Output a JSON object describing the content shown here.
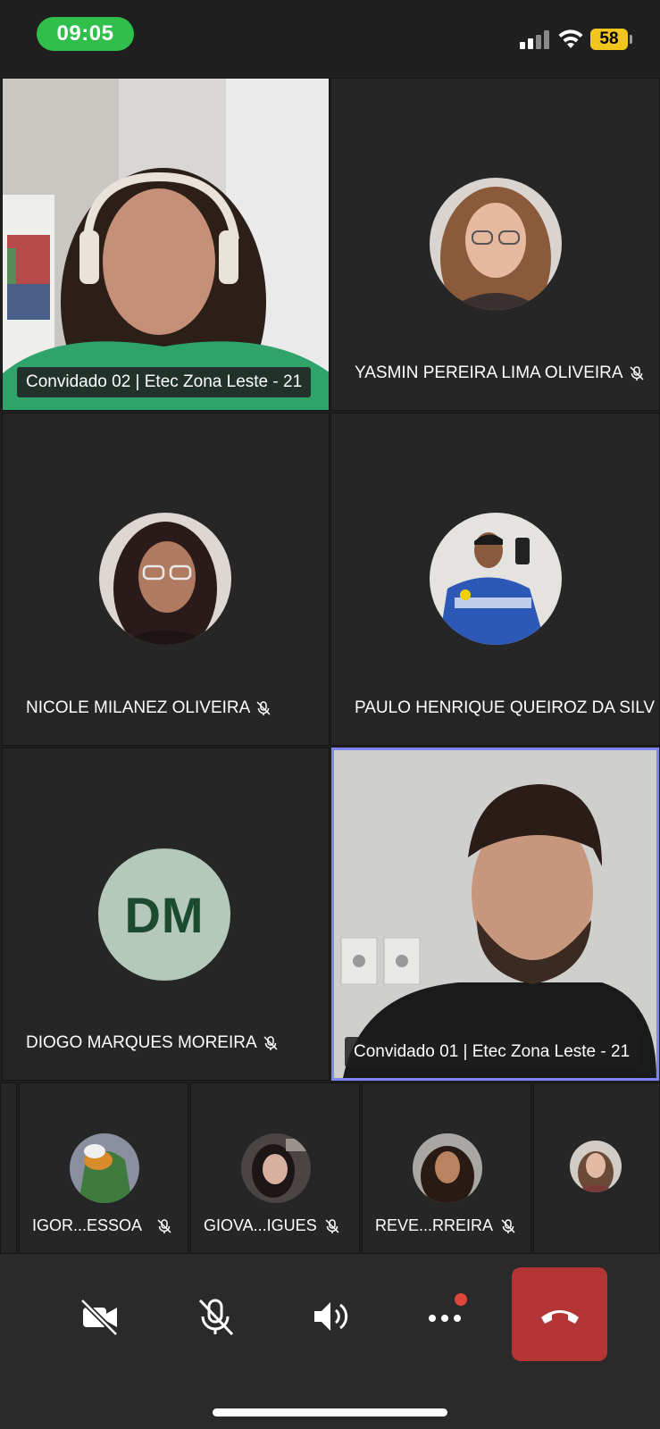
{
  "status": {
    "time": "09:05",
    "battery": "58"
  },
  "tiles": [
    {
      "name": "Convidado 02 | Etec Zona Leste - 21",
      "type": "video"
    },
    {
      "name": "YASMIN PEREIRA LIMA OLIVEIRA",
      "type": "avatar",
      "muted": true
    },
    {
      "name": "NICOLE MILANEZ OLIVEIRA",
      "type": "avatar",
      "muted": true
    },
    {
      "name": "PAULO HENRIQUE QUEIROZ DA SILV",
      "type": "avatar",
      "muted": false
    },
    {
      "name": "DIOGO MARQUES MOREIRA",
      "type": "initials",
      "initials": "DM",
      "muted": true
    },
    {
      "name": "Convidado 01 | Etec Zona Leste - 21",
      "type": "video",
      "active": true
    }
  ],
  "strip": [
    {
      "name": "IGOR...ESSOA",
      "muted": true
    },
    {
      "name": "GIOVA...IGUES",
      "muted": true
    },
    {
      "name": "REVE...RREIRA",
      "muted": true
    },
    {
      "name": "",
      "muted": false
    }
  ],
  "controls": {
    "camera_icon": "camera-off-icon",
    "mic_icon": "mic-off-icon",
    "speaker_icon": "speaker-icon",
    "more_icon": "more-icon",
    "hangup_icon": "hang-up-icon"
  },
  "colors": {
    "background": "#1f1f1f",
    "active_border": "#7f85f5",
    "hangup": "#b43535",
    "time_pill": "#2fbf4a",
    "battery": "#f2c51d",
    "initials_bg": "#b4c9b9",
    "initials_fg": "#1c4a30"
  }
}
